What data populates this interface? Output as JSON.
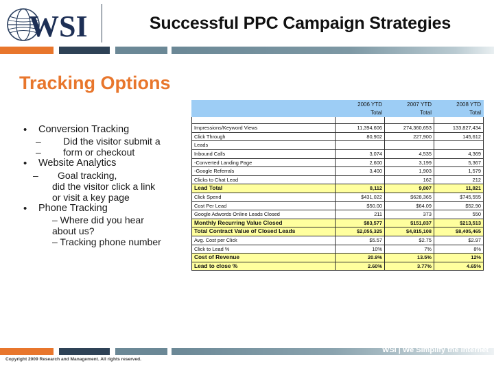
{
  "header": {
    "logo_text": "WSI",
    "deck_title": "Successful PPC Campaign Strategies"
  },
  "section": {
    "title": "Tracking Options"
  },
  "bullets": [
    {
      "level": "lvl1",
      "mark": "•",
      "text": "Conversion Tracking"
    },
    {
      "level": "lvl2",
      "mark": "–",
      "text": "Did the visitor submit a"
    },
    {
      "level": "lvl2",
      "mark": "–",
      "text": "form or checkout"
    },
    {
      "level": "lvl1",
      "mark": "•",
      "text": "Website Analytics"
    },
    {
      "level": "lvl-dash1",
      "mark": "–",
      "text": "Goal tracking,"
    },
    {
      "level": "lvl-plain",
      "mark": "",
      "text": "did the visitor click a link"
    },
    {
      "level": "lvl-plain",
      "mark": "",
      "text": "or visit a key page"
    },
    {
      "level": "lvl1",
      "mark": "•",
      "text": "Phone Tracking"
    },
    {
      "level": "lvl-plain",
      "mark": "",
      "text": "– Where did you hear"
    },
    {
      "level": "lvl-plain",
      "mark": "",
      "text": "about us?"
    },
    {
      "level": "lvl-plain",
      "mark": "",
      "text": "–  Tracking phone number"
    }
  ],
  "table": {
    "corner_label": "",
    "columns": [
      "2006 YTD\nTotal",
      "2007 YTD\nTotal",
      "2008 YTD\nTotal"
    ],
    "col_2006_l1": "2006 YTD",
    "col_2006_l2": "Total",
    "col_2007_l1": "2007 YTD",
    "col_2007_l2": "Total",
    "col_2008_l1": "2008 YTD",
    "col_2008_l2": "Total",
    "rows": [
      {
        "label": "Impressions/Keyword Views",
        "v2006": "11,394,606",
        "v2007": "274,360,653",
        "v2008": "133,827,434",
        "style": "plain",
        "indent": false
      },
      {
        "label": "Click Through",
        "v2006": "80,902",
        "v2007": "227,900",
        "v2008": "145,612",
        "style": "plain",
        "indent": false
      },
      {
        "label": "Leads",
        "v2006": "",
        "v2007": "",
        "v2008": "",
        "style": "plain",
        "indent": false
      },
      {
        "label": "Inbound Calls",
        "v2006": "3,074",
        "v2007": "4,535",
        "v2008": "4,369",
        "style": "plain",
        "indent": true
      },
      {
        "label": "-Converted Landing Page",
        "v2006": "2,600",
        "v2007": "3,199",
        "v2008": "5,367",
        "style": "plain",
        "indent": false
      },
      {
        "label": "-Google Referrals",
        "v2006": "3,400",
        "v2007": "1,903",
        "v2008": "1,579",
        "style": "plain",
        "indent": false
      },
      {
        "label": "Clicks to Chat Lead",
        "v2006": "",
        "v2007": "162",
        "v2008": "212",
        "style": "plain",
        "indent": true
      },
      {
        "label": "Lead Total",
        "v2006": "8,112",
        "v2007": "9,807",
        "v2008": "11,821",
        "style": "yellow",
        "indent": false
      },
      {
        "label": "Click Spend",
        "v2006": "$431,022",
        "v2007": "$628,365",
        "v2008": "$745,555",
        "style": "plain",
        "indent": false
      },
      {
        "label": "Cost Per Lead",
        "v2006": "$50.00",
        "v2007": "$64.09",
        "v2008": "$52.90",
        "style": "plain",
        "indent": false
      },
      {
        "label": "Google Adwords Online Leads Closed",
        "v2006": "211",
        "v2007": "373",
        "v2008": "550",
        "style": "plain",
        "indent": false
      },
      {
        "label": "Monthly Recurring Value Closed",
        "v2006": "$83,577",
        "v2007": "$151,837",
        "v2008": "$213,513",
        "style": "yellow",
        "indent": false
      },
      {
        "label": "Total Contract Value of Closed Leads",
        "v2006": "$2,055,325",
        "v2007": "$4,815,108",
        "v2008": "$8,405,465",
        "style": "yellow",
        "indent": false
      },
      {
        "label": "Avg. Cost per Click",
        "v2006": "$5.57",
        "v2007": "$2.75",
        "v2008": "$2.97",
        "style": "plain",
        "indent": false
      },
      {
        "label": "Click to Lead %",
        "v2006": "10%",
        "v2007": "7%",
        "v2008": "8%",
        "style": "plain",
        "indent": false
      },
      {
        "label": "Cost of Revenue",
        "v2006": "20.9%",
        "v2007": "13.5%",
        "v2008": "12%",
        "style": "yellow",
        "indent": false
      },
      {
        "label": "Lead to close %",
        "v2006": "2.60%",
        "v2007": "3.77%",
        "v2008": "4.65%",
        "style": "yellow",
        "indent": false
      }
    ]
  },
  "footer": {
    "copyright": "Copyright 2009 Research and Management. All rights reserved.",
    "tagline": "WSI | We Simplify the Internet"
  },
  "colors": {
    "accent_orange": "#e8762c",
    "navy": "#2e4256",
    "steel": "#6b8896",
    "table_header_blue": "#9dcdf5",
    "highlight_yellow": "#ffff9e"
  }
}
